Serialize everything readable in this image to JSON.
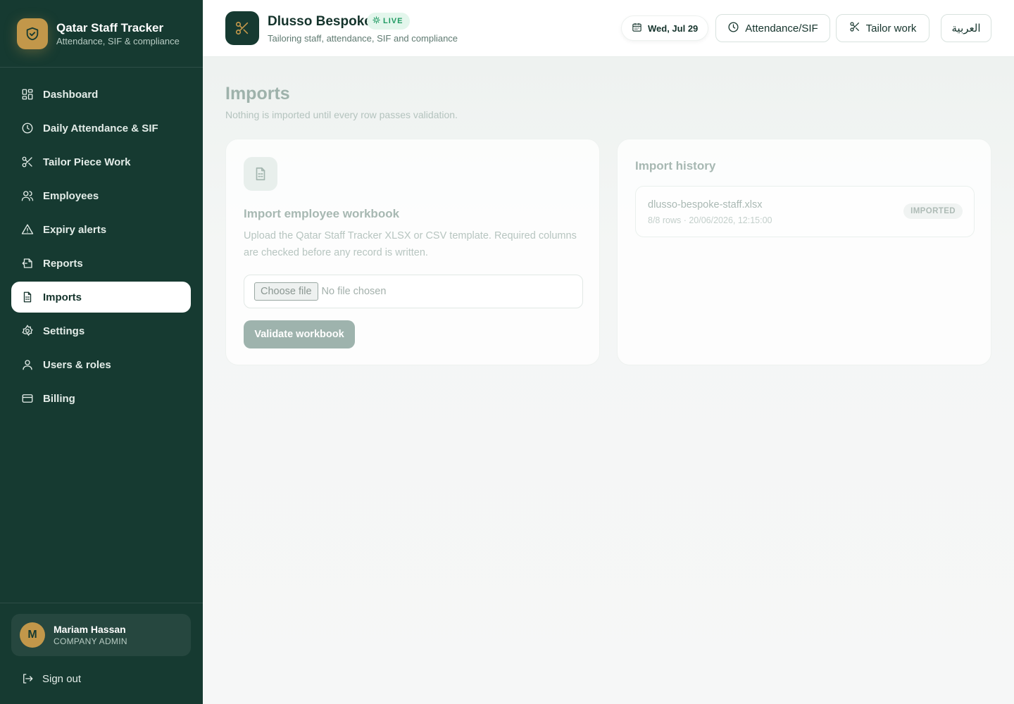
{
  "brand": {
    "title": "Qatar Staff Tracker",
    "subtitle": "Attendance, SIF & compliance",
    "icon": "shield-check-icon"
  },
  "sidebar": {
    "items": [
      {
        "label": "Dashboard",
        "icon": "dashboard-icon"
      },
      {
        "label": "Daily Attendance & SIF",
        "icon": "clock-icon"
      },
      {
        "label": "Tailor Piece Work",
        "icon": "scissors-icon"
      },
      {
        "label": "Employees",
        "icon": "users-icon"
      },
      {
        "label": "Expiry alerts",
        "icon": "alert-triangle-icon"
      },
      {
        "label": "Reports",
        "icon": "file-export-icon"
      },
      {
        "label": "Imports",
        "icon": "file-spreadsheet-icon",
        "active": true
      },
      {
        "label": "Settings",
        "icon": "gear-icon"
      },
      {
        "label": "Users & roles",
        "icon": "user-icon"
      },
      {
        "label": "Billing",
        "icon": "credit-card-icon"
      }
    ]
  },
  "user": {
    "initial": "M",
    "name": "Mariam Hassan",
    "role": "COMPANY ADMIN",
    "signout_label": "Sign out"
  },
  "header": {
    "company_name": "Dlusso Bespoke",
    "live_badge": "LIVE",
    "company_subtitle": "Tailoring staff, attendance, SIF and compliance",
    "date": "Wed, Jul 29",
    "attendance_button": "Attendance/SIF",
    "tailor_button": "Tailor work",
    "language_button": "العربية"
  },
  "main": {
    "title": "Imports",
    "subtitle": "Nothing is imported until every row passes validation."
  },
  "import_card": {
    "title": "Import employee workbook",
    "description": "Upload the Qatar Staff Tracker XLSX or CSV template. Required columns are checked before any record is written.",
    "choose_file_label": "Choose file",
    "no_file_label": "No file chosen",
    "validate_label": "Validate workbook"
  },
  "history": {
    "title": "Import history",
    "items": [
      {
        "filename": "dlusso-bespoke-staff.xlsx",
        "meta": "8/8 rows · 20/06/2026, 12:15:00",
        "status": "IMPORTED"
      }
    ]
  },
  "colors": {
    "sidebar_bg": "#163a31",
    "accent_gold": "#c2974a",
    "live_green": "#1f9a62"
  }
}
